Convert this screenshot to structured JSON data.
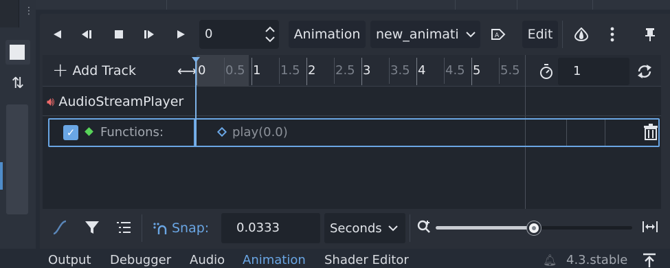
{
  "toolbar": {
    "frame_value": "0",
    "animation_label": "Animation",
    "animation_selected": "new_animati",
    "edit_label": "Edit"
  },
  "timeline": {
    "add_track_label": "Add Track",
    "ticks": [
      "0",
      "0.5",
      "1",
      "1.5",
      "2",
      "2.5",
      "3",
      "3.5",
      "4",
      "4.5",
      "5",
      "5.5"
    ],
    "length_value": "1"
  },
  "tracks": {
    "player_name": "AudioStreamPlayer",
    "function_label": "Functions:",
    "key_label": "play(0.0)"
  },
  "bottom_toolbar": {
    "snap_label": "Snap:",
    "snap_value": "0.0333",
    "units_selected": "Seconds",
    "zoom_fraction": 0.5
  },
  "bottom_tabs": {
    "tabs": [
      "Output",
      "Debugger",
      "Audio",
      "Animation",
      "Shader Editor"
    ],
    "active": "Animation",
    "version": "4.3.stable"
  },
  "colors": {
    "accent": "#6aa6e4",
    "panel_bg": "#2a2f38",
    "audio_icon": "#ee6a6a",
    "func_diamond": "#58d45a"
  }
}
